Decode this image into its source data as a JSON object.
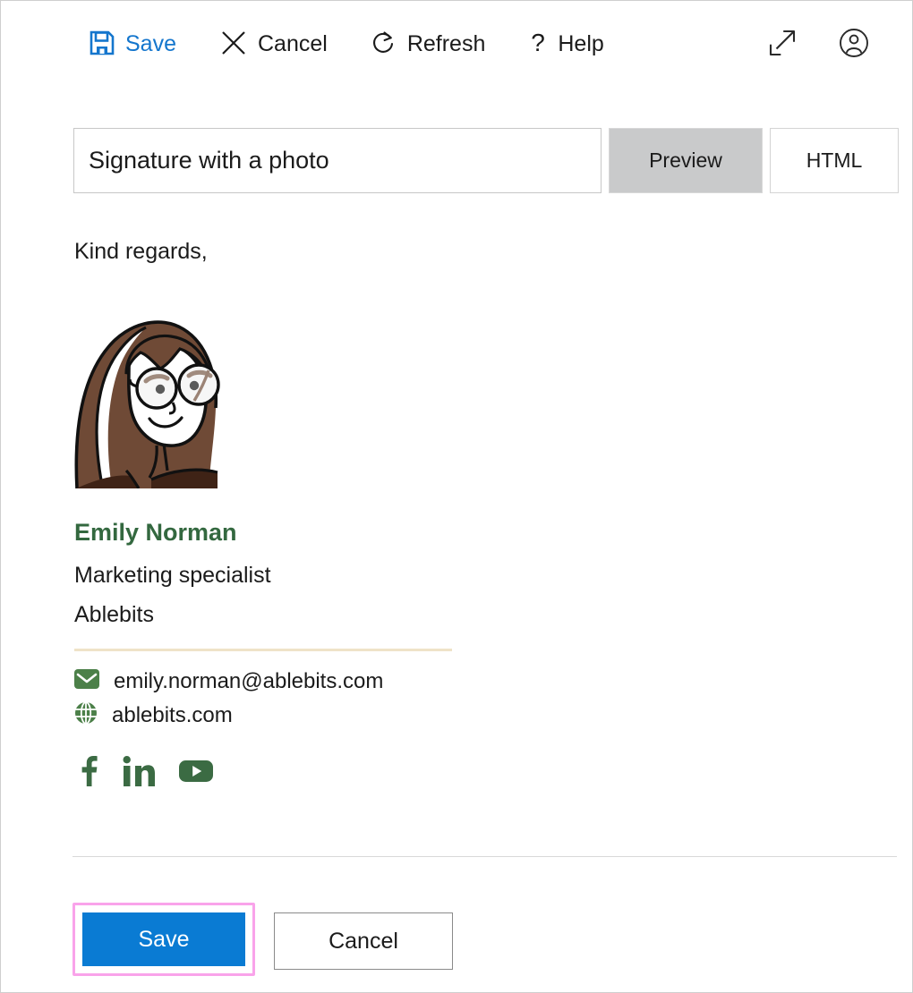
{
  "toolbar": {
    "items": [
      {
        "label": "Save",
        "icon": "save-disk-icon",
        "primary": true
      },
      {
        "label": "Cancel",
        "icon": "close-x-icon",
        "primary": false
      },
      {
        "label": "Refresh",
        "icon": "refresh-icon",
        "primary": false
      },
      {
        "label": "Help",
        "icon": "question-mark-icon",
        "primary": false
      }
    ],
    "expand_icon": "expand-diagonal-icon",
    "account_icon": "account-circle-icon"
  },
  "title_row": {
    "signature_name": "Signature with a photo",
    "signature_name_placeholder": "Signature name",
    "preview_label": "Preview",
    "html_label": "HTML",
    "active_mode": "Preview"
  },
  "signature": {
    "greeting": "Kind regards,",
    "photo_alt": "portrait-illustration",
    "name": "Emily Norman",
    "job_title": "Marketing specialist",
    "company": "Ablebits",
    "contacts": [
      {
        "icon": "envelope-icon",
        "text": "emily.norman@ablebits.com"
      },
      {
        "icon": "globe-icon",
        "text": "ablebits.com"
      }
    ],
    "social": [
      {
        "icon": "facebook-icon"
      },
      {
        "icon": "linkedin-icon"
      },
      {
        "icon": "youtube-icon"
      }
    ]
  },
  "footer": {
    "save_label": "Save",
    "cancel_label": "Cancel"
  },
  "colors": {
    "accent_blue": "#0a7bd3",
    "toolbar_link_blue": "#1476cd",
    "signature_green": "#33683f",
    "divider_beige": "#efe3c8",
    "highlight_pink": "#f9a3ea",
    "hair_brown": "#6f4a36",
    "shirt_brown": "#3f2316"
  }
}
